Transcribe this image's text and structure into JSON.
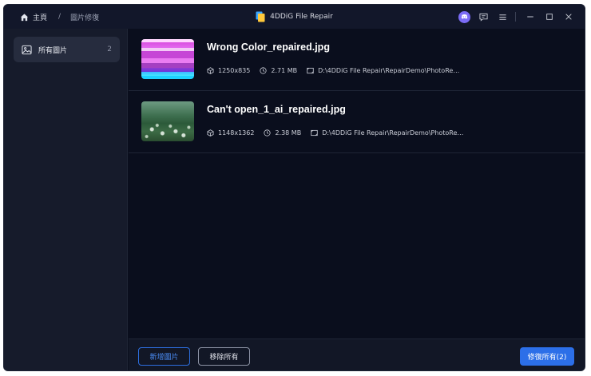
{
  "breadcrumb": {
    "home": "主頁",
    "separator": "/",
    "current": "圖片修復"
  },
  "app": {
    "title": "4DDiG File Repair"
  },
  "icons": {
    "home": "home-icon",
    "discord": "discord-icon",
    "feedback": "feedback-icon",
    "menu": "menu-icon",
    "minimize": "minimize-icon",
    "maximize": "maximize-icon",
    "close": "close-icon",
    "image": "image-icon",
    "dimensions": "cube-icon",
    "size": "clock-icon",
    "path": "folder-path-icon"
  },
  "sidebar": {
    "items": [
      {
        "label": "所有圖片",
        "count": "2"
      }
    ]
  },
  "files": [
    {
      "name": "Wrong Color_repaired.jpg",
      "dimensions": "1250x835",
      "size": "2.71 MB",
      "path": "D:\\4DDiG File Repair\\RepairDemo\\PhotoRepair..."
    },
    {
      "name": "Can't open_1_ai_repaired.jpg",
      "dimensions": "1148x1362",
      "size": "2.38 MB",
      "path": "D:\\4DDiG File Repair\\RepairDemo\\PhotoRepair..."
    }
  ],
  "footer": {
    "add": "新增圖片",
    "remove_all": "移除所有",
    "repair_all": "修復所有(2)"
  },
  "colors": {
    "accent": "#2c6fe8",
    "background": "#0a0e1d",
    "sidebar": "#161b2b",
    "discord": "#7b6cf6"
  }
}
